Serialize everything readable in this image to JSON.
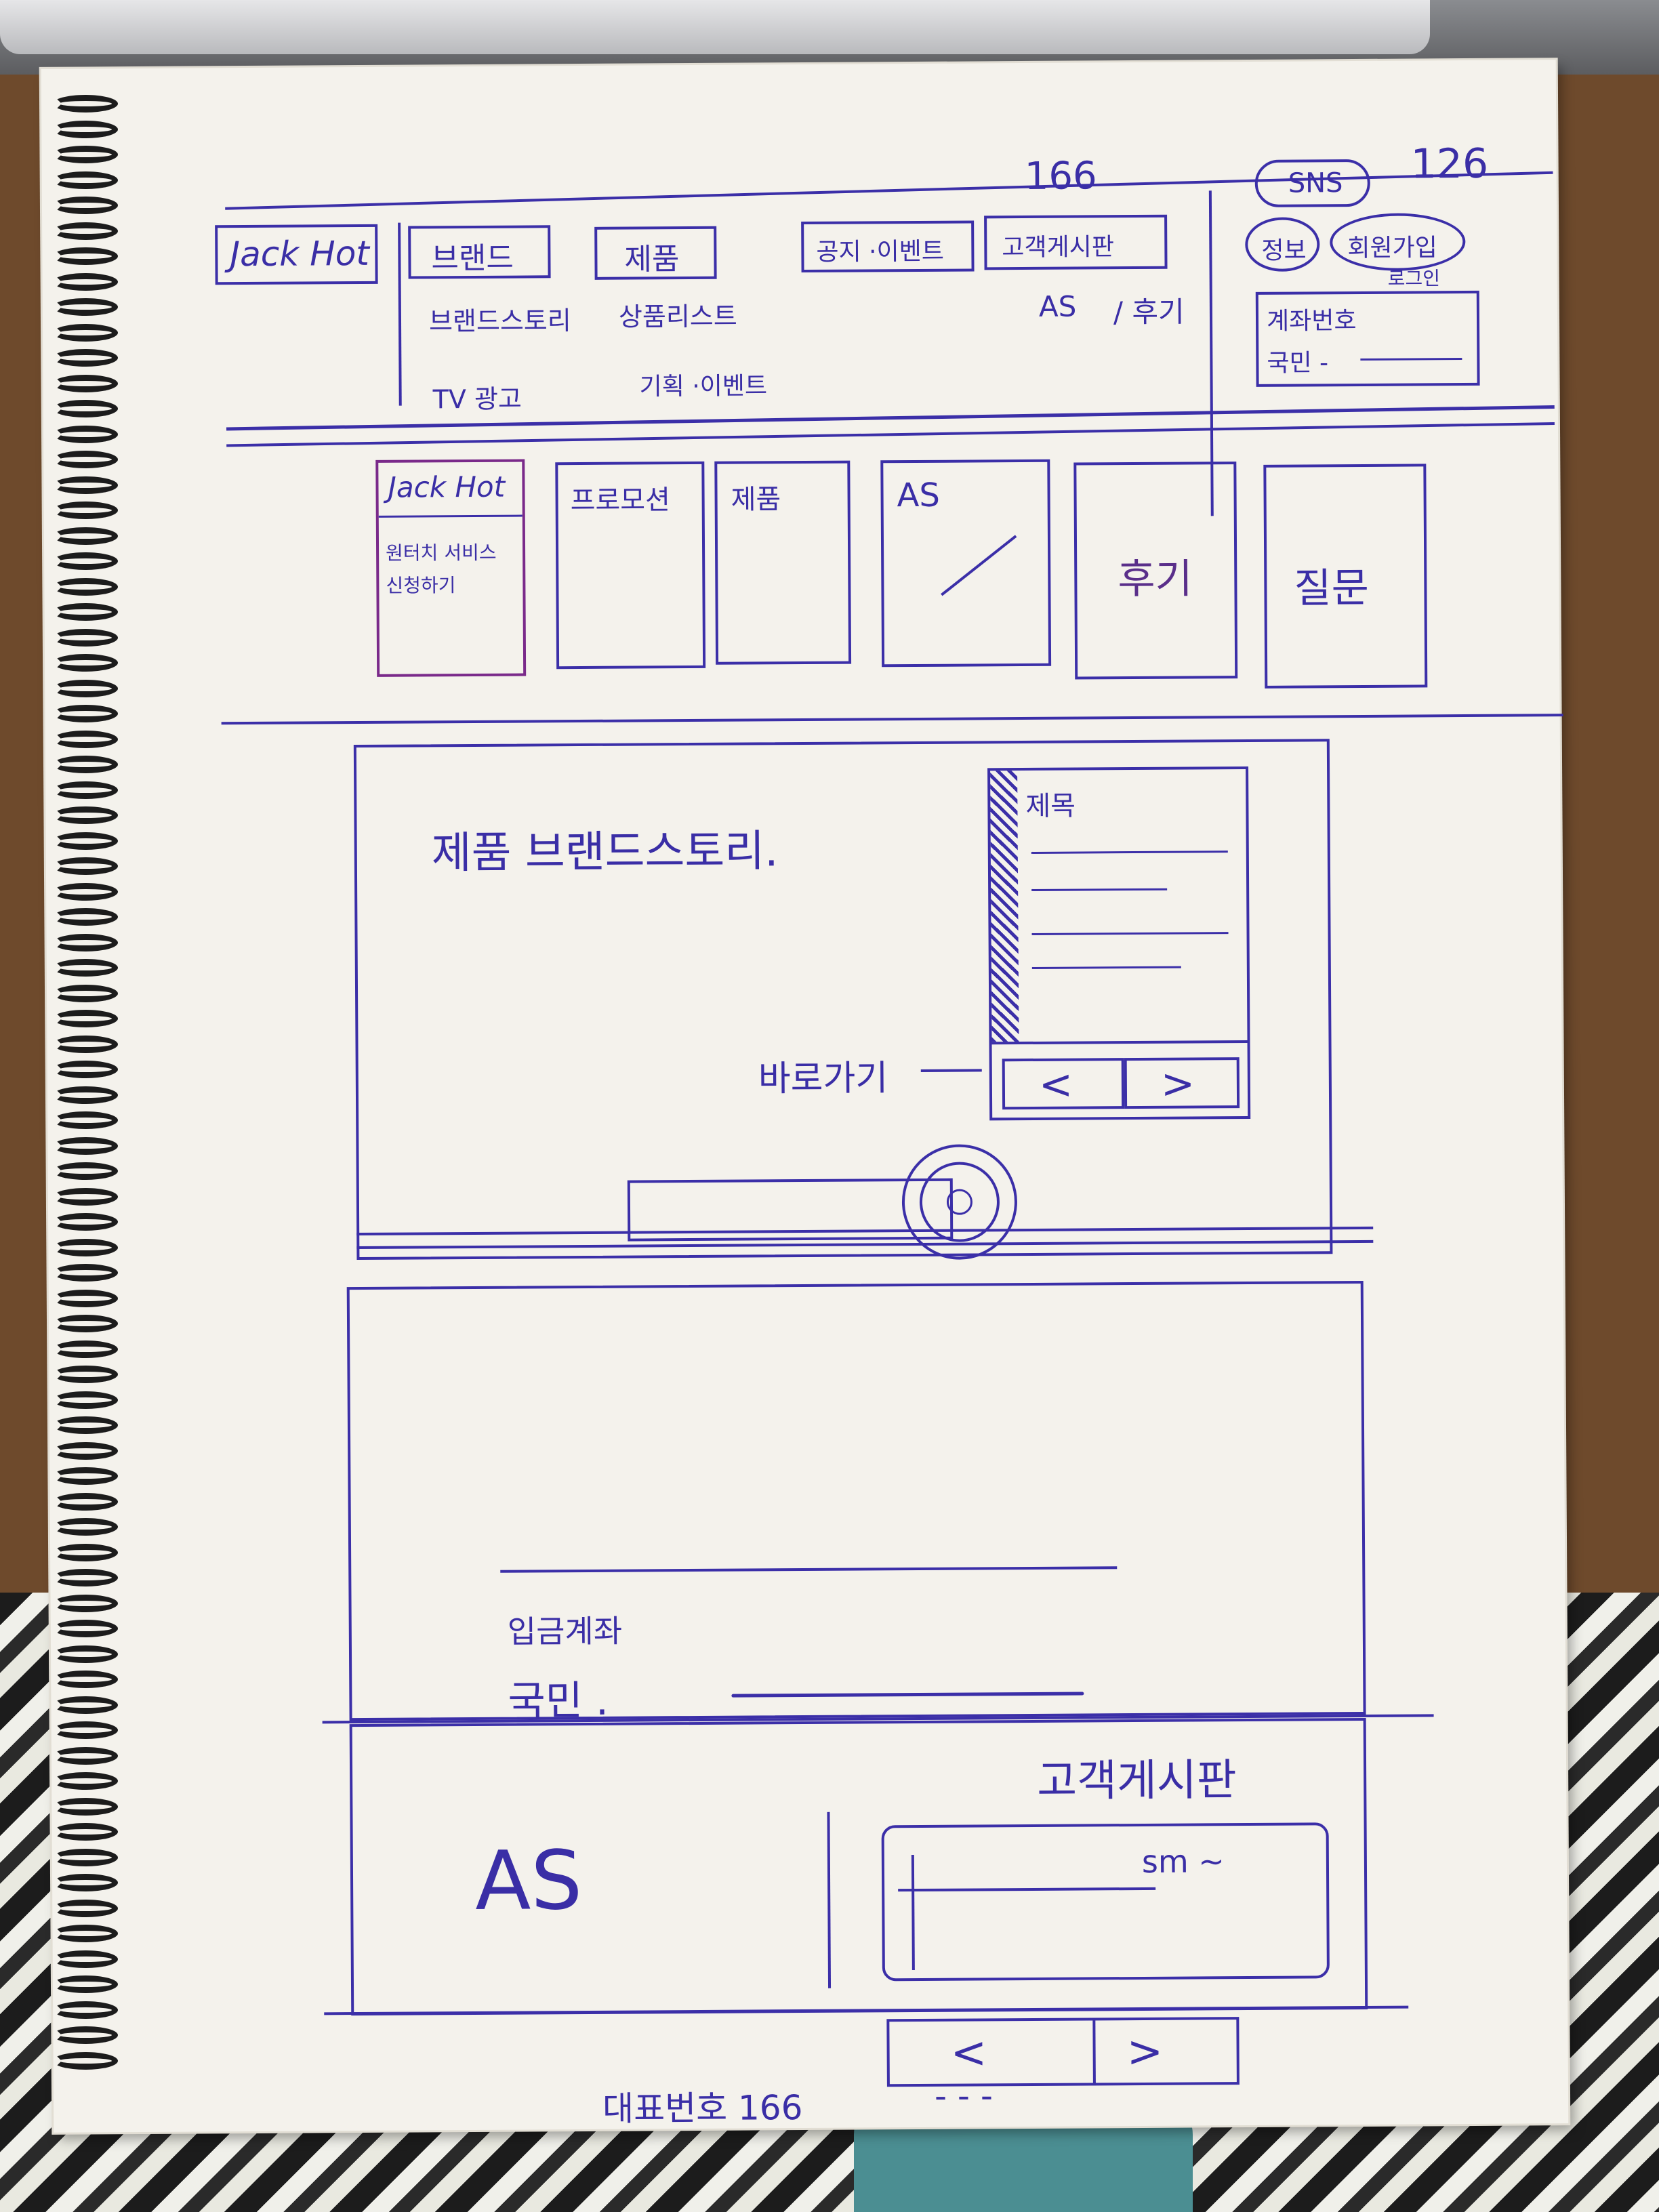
{
  "sketch": {
    "page_numbers": {
      "left": "166",
      "right": "126"
    },
    "header": {
      "logo": "Jack Hot",
      "menus": [
        {
          "label": "브랜드",
          "subitems": [
            "브랜드스토리",
            "TV 광고"
          ]
        },
        {
          "label": "제품",
          "subitems": [
            "상품리스트",
            "기획 ·이벤트"
          ]
        },
        {
          "label": "공지 ·이벤트",
          "subitems": []
        },
        {
          "label": "고객게시판",
          "subitems": [
            "AS",
            "/ 후기"
          ]
        }
      ],
      "sns": "SNS",
      "account_buttons": [
        "정보",
        "회원가입"
      ],
      "login_note": "로그인",
      "bank_box": {
        "title": "계좌번호",
        "owner": "국민 -"
      }
    },
    "tiles": [
      {
        "title": "Jack Hot",
        "body": "원터치 서비스 신청하기"
      },
      {
        "title": "프로모션",
        "body": ""
      },
      {
        "title": "제품",
        "body": ""
      },
      {
        "title": "AS",
        "body": ""
      },
      {
        "title": "후기",
        "body": ""
      },
      {
        "title": "질문",
        "body": ""
      }
    ],
    "hero": {
      "title": "제품 브랜드스토리.",
      "shortcut": "바로가기",
      "side_panel_title": "제목",
      "prev": "<",
      "next": ">"
    },
    "deposit": {
      "title": "입금계좌",
      "bank": "국민 ."
    },
    "bottom": {
      "as_label": "AS",
      "board_title": "고객게시판",
      "board_item": "sm ~",
      "prev": "<",
      "next": ">"
    },
    "footer": {
      "phone_label": "대표번호 166",
      "phone_tail": "- - -"
    }
  }
}
